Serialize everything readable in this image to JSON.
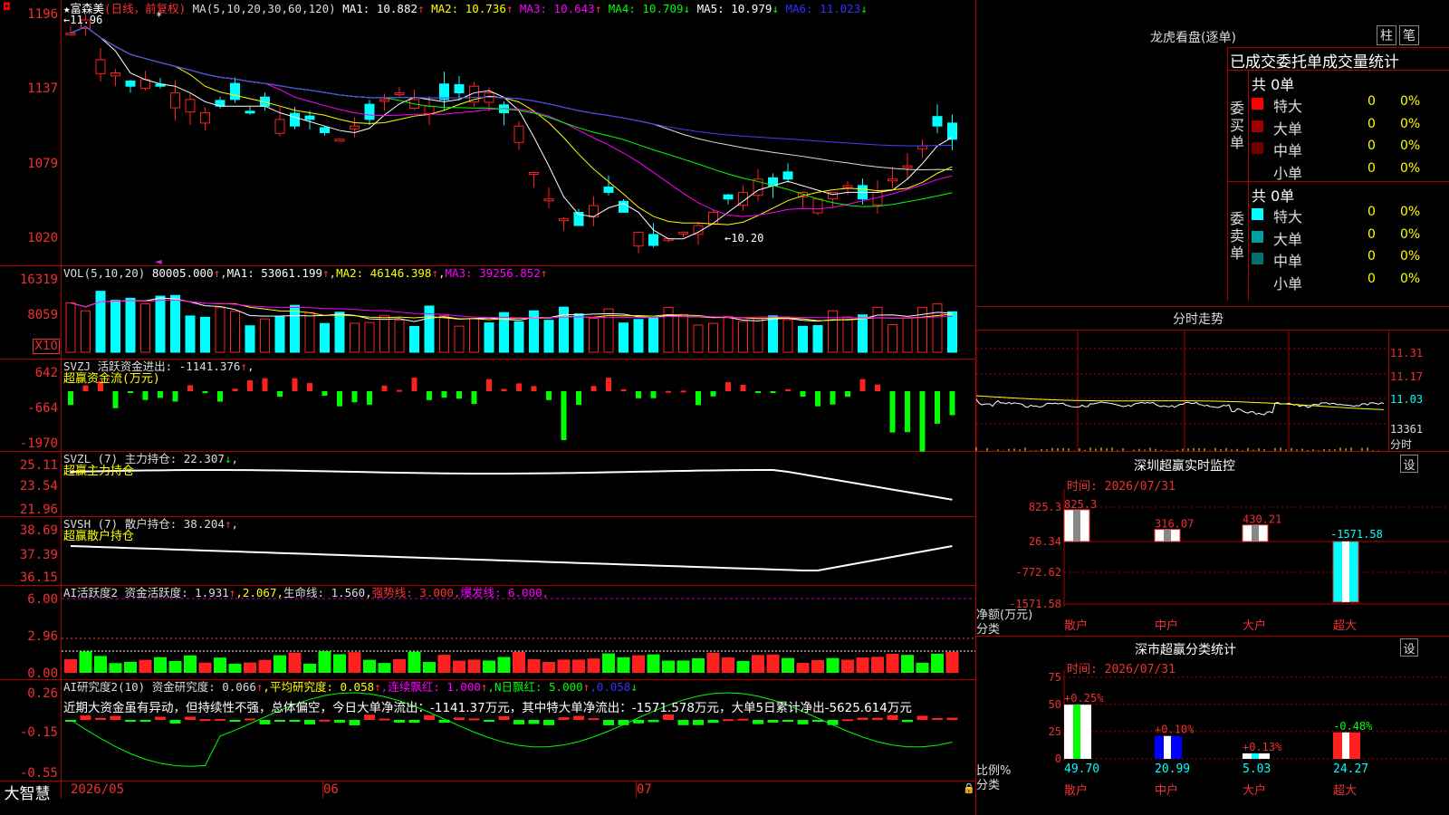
{
  "stock": {
    "name": "富森美",
    "period": "(日线，前复权)",
    "ma_label": "MA(5,10,20,30,60,120)",
    "ma": [
      {
        "label": "MA1: 10.882",
        "arrow": "↑",
        "color": "#ffffff"
      },
      {
        "label": "MA2: 10.736",
        "arrow": "↑",
        "color": "#ffff00"
      },
      {
        "label": "MA3: 10.643",
        "arrow": "↑",
        "color": "#ff00ff"
      },
      {
        "label": "MA4: 10.709",
        "arrow": "↓",
        "color": "#00ff00"
      },
      {
        "label": "MA5: 10.979",
        "arrow": "↓",
        "color": "#ffffff"
      },
      {
        "label": "MA6: 11.023",
        "arrow": "↓",
        "color": "#3030ff"
      }
    ],
    "high_marker": "11.96",
    "low_marker": "10.20",
    "star": "*"
  },
  "price_axis": [
    "1196",
    "1137",
    "1079",
    "1020"
  ],
  "volume": {
    "label": "VOL(5,10,20)",
    "value": "80005.000",
    "arrow": "↑",
    "ma1": "MA1: 53061.199",
    "ma2": "MA2: 46146.398",
    "ma3": "MA3: 39256.852",
    "axis": [
      "16319",
      "8059"
    ],
    "unit": "X10"
  },
  "svzj": {
    "label": "SVZJ  活跃资金进出: -1141.376",
    "arrow": "↑",
    "suffix": ",",
    "subtitle": "超赢资金流(万元)",
    "axis": [
      "642",
      "-664",
      "-1970"
    ]
  },
  "svzl": {
    "label": "SVZL (7) 主力持仓: 22.307",
    "arrow": "↓",
    "suffix": ",",
    "subtitle": "超赢主力持仓",
    "axis": [
      "25.11",
      "23.54",
      "21.96"
    ]
  },
  "svsh": {
    "label": "SVSH (7) 散户持仓: 38.204",
    "arrow": "↑",
    "suffix": ",",
    "subtitle": "超赢散户持仓",
    "axis": [
      "38.69",
      "37.39",
      "36.15"
    ]
  },
  "ai_active": {
    "label": "AI活跃度2 资金活跃度: 1.931",
    "arrow": "↑",
    "v2": ",2.067,",
    "life": "生命线: 1.560,",
    "strong": "强势线: 3.000,",
    "burst": "爆发线: 6.000,",
    "axis": [
      "6.00",
      "2.96",
      "0.00"
    ]
  },
  "ai_research": {
    "label": "AI研究度2(10) 资金研究度: 0.066",
    "arrow": "↑",
    "avg": ",平均研究度: 0.058",
    "avg_arrow": "↑",
    "consec": ",连续飘红: 1.000",
    "consec_arrow": "↑",
    "nday": ",N日飘红: 5.000",
    "nday_arrow": "↑",
    "last": ",0.058",
    "last_arrow": "↓",
    "comment": "近期大资金虽有异动，但持续性不强，总体偏空，今日大单净流出：-1141.37万元，其中特大单净流出：-1571.578万元，大单5日累计净出-5625.614万元",
    "axis": [
      "0.26",
      "-0.15",
      "-0.55"
    ]
  },
  "dates": [
    "2026/05",
    "06",
    "07"
  ],
  "brand": "大智慧",
  "right": {
    "lhb_title": "龙虎看盘(逐单)",
    "btn_zhu": "柱",
    "btn_bi": "笔",
    "stats_header": "已成交委托单成交量统计",
    "buy_label": "委买单",
    "sell_label": "委卖单",
    "total_buy": "共 0单",
    "total_sell": "共 0单",
    "buy_rows": [
      {
        "name": "特大",
        "n": "0",
        "pct": "0%",
        "color": "#ff0000"
      },
      {
        "name": "大单",
        "n": "0",
        "pct": "0%",
        "color": "#a00000"
      },
      {
        "name": "中单",
        "n": "0",
        "pct": "0%",
        "color": "#700000"
      },
      {
        "name": "小单",
        "n": "0",
        "pct": "0%",
        "color": "#000000"
      }
    ],
    "sell_rows": [
      {
        "name": "特大",
        "n": "0",
        "pct": "0%",
        "color": "#00ffff"
      },
      {
        "name": "大单",
        "n": "0",
        "pct": "0%",
        "color": "#00a0a0"
      },
      {
        "name": "中单",
        "n": "0",
        "pct": "0%",
        "color": "#007070"
      },
      {
        "name": "小单",
        "n": "0",
        "pct": "0%",
        "color": "#000000"
      }
    ],
    "fenshi_title": "分时走势",
    "fenshi_axis": [
      "11.31",
      "11.17",
      "11.03"
    ],
    "fenshi_vol": "13361",
    "fenshi_vol_unit": "分时",
    "sz_title": "深圳超赢实时监控",
    "sz_btn": "设",
    "sz_time": "时间: 2026/07/31",
    "sz_axis": [
      "825.3",
      "26.34",
      "-772.62",
      "-1571.58"
    ],
    "sz_unit": "净额(万元)",
    "sz_cat_label": "分类",
    "sz_values": [
      {
        "cat": "散户",
        "val": "825.3"
      },
      {
        "cat": "中户",
        "val": "316.07"
      },
      {
        "cat": "大户",
        "val": "430.21"
      },
      {
        "cat": "超大",
        "val": "-1571.58"
      }
    ],
    "cls_title": "深市超赢分类统计",
    "cls_btn": "设",
    "cls_time": "时间: 2026/07/31",
    "cls_axis": [
      "75",
      "50",
      "25",
      "0"
    ],
    "cls_unit": "比例%",
    "cls_cat_label": "分类",
    "cls_values": [
      {
        "cat": "散户",
        "chg": "+0.25%",
        "val": "49.70"
      },
      {
        "cat": "中户",
        "chg": "+0.10%",
        "val": "20.99"
      },
      {
        "cat": "大户",
        "chg": "+0.13%",
        "val": "5.03"
      },
      {
        "cat": "超大",
        "chg": "-0.48%",
        "val": "24.27"
      }
    ]
  },
  "colors": {
    "up": "#ff2020",
    "down": "#00ffff",
    "grid": "#b00000",
    "axis_text": "#f03030"
  }
}
